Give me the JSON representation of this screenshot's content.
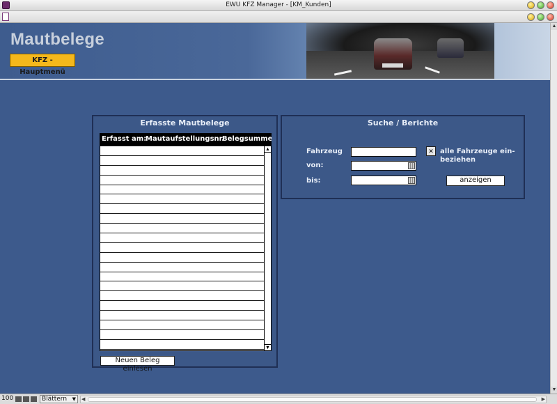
{
  "window": {
    "title": "EWU KFZ Manager - [KM_Kunden]"
  },
  "header": {
    "page_title": "Mautbelege",
    "main_menu_label": "KFZ - Hauptmenü"
  },
  "receipts_panel": {
    "title": "Erfasste Mautbelege",
    "columns": [
      "Erfasst am:",
      "Mautaufstellungsnr.",
      "Belegsumme"
    ],
    "rows": [],
    "new_button_label": "Neuen Beleg einlesen"
  },
  "search_panel": {
    "title": "Suche / Berichte",
    "vehicle_label": "Fahrzeug",
    "vehicle_value": "",
    "from_label": "von:",
    "from_value": "",
    "to_label": "bis:",
    "to_value": "",
    "all_vehicles_checked": true,
    "all_vehicles_label_line1": "alle Fahrzeuge ein-",
    "all_vehicles_label_line2": "beziehen",
    "show_button_label": "anzeigen"
  },
  "statusbar": {
    "zoom": "100",
    "mode": "Blättern"
  },
  "icons": {
    "checkbox": "x-mark",
    "calendar": "calendar-icon"
  }
}
